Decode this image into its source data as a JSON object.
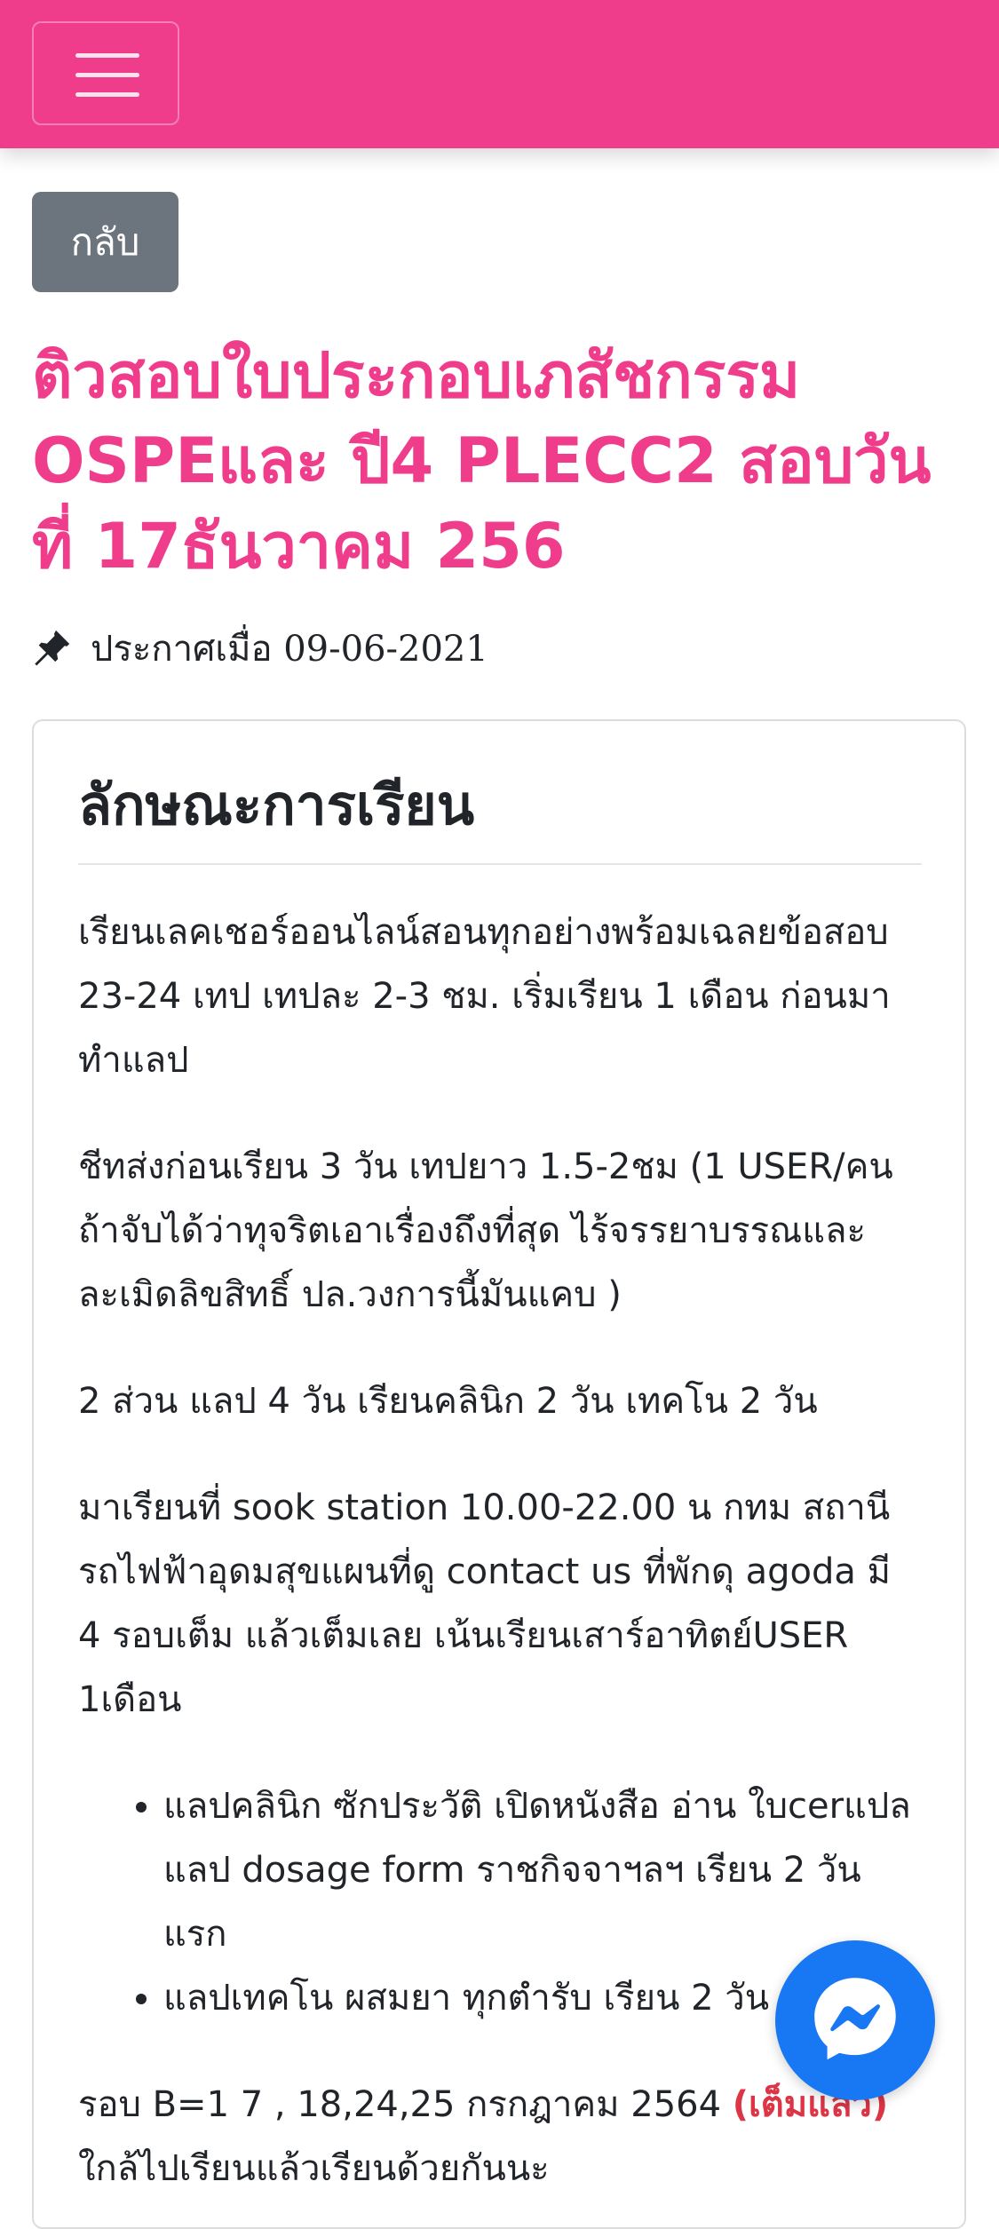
{
  "colors": {
    "brand_pink": "#ef3d8b",
    "back_button_gray": "#6c757d",
    "full_red": "#dc3545",
    "messenger_blue": "#1877f2"
  },
  "header": {
    "menu_icon": "hamburger-menu-icon"
  },
  "back_button": {
    "label": "กลับ"
  },
  "article": {
    "title": "ติวสอบใบประกอบเภสัชกรรม OSPEและ ปี4 PLECC2 สอบวันที่ 17ธันวาคม 256",
    "posted_icon": "pin-icon",
    "posted_text": "ประกาศเมื่อ 09-06-2021"
  },
  "card": {
    "heading": "ลักษณะการเรียน",
    "paragraphs": [
      "เรียนเลคเชอร์ออนไลน์สอนทุกอย่างพร้อมเฉลยข้อสอบ 23-24 เทป เทปละ 2-3 ชม. เริ่มเรียน 1 เดือน ก่อนมาทำแลป",
      "ชีทส่งก่อนเรียน 3 วัน เทปยาว 1.5-2ชม (1 USER/คน ถ้าจับได้ว่าทุจริตเอาเรื่องถึงที่สุด ไร้จรรยาบรรณและ ละเมิดลิขสิทธิ์ ปล.วงการนี้มันแคบ )",
      "2 ส่วน แลป 4 วัน เรียนคลินิก 2 วัน เทคโน 2 วัน",
      "มาเรียนที่ sook station 10.00-22.00 น กทม สถานีรถไฟฟ้าอุดมสุขแผนที่ดู contact us ที่พักดุ agoda มี 4 รอบเต็ม แล้วเต็มเลย เน้นเรียนเสาร์อาทิตย์USER 1เดือน"
    ],
    "bullets": [
      "แลปคลินิก ซักประวัติ เปิดหนังสือ อ่าน ใบcerแปลแลป dosage form ราชกิจจาฯลฯ เรียน 2 วันแรก",
      "แลปเทคโน ผสมยา ทุกตำรับ เรียน 2 วัน"
    ],
    "round_text": "รอบ B=1 7 , 18,24,25 กรกฎาคม 2564 ",
    "round_full": "(เต็มแล้ว)",
    "round_after": " ใกล้ไปเรียนแล้วเรียนด้วยกันนะ"
  },
  "messenger": {
    "icon": "messenger-icon"
  }
}
